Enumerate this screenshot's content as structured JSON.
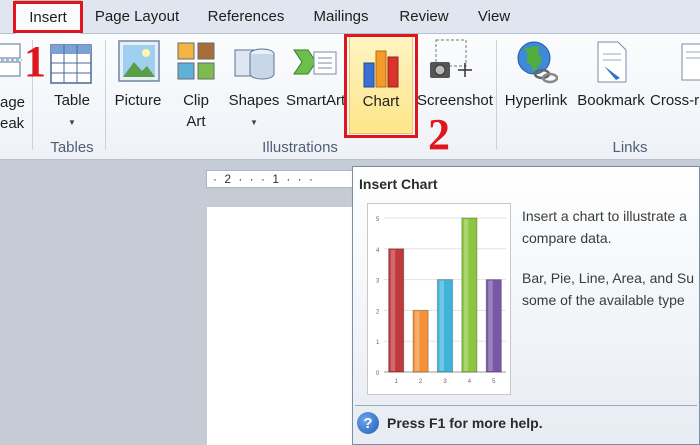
{
  "tabs": [
    "Insert",
    "Page Layout",
    "References",
    "Mailings",
    "Review",
    "View"
  ],
  "groups": {
    "pages": {
      "label_line1": "age",
      "label_line2": "eak"
    },
    "tables": {
      "label": "Tables",
      "table_button": "Table"
    },
    "illustrations": {
      "label": "Illustrations",
      "picture": "Picture",
      "clipart_line1": "Clip",
      "clipart_line2": "Art",
      "shapes": "Shapes",
      "smartart": "SmartArt",
      "chart": "Chart",
      "screenshot": "Screenshot"
    },
    "links": {
      "label": "Links",
      "hyperlink": "Hyperlink",
      "bookmark": "Bookmark",
      "crossref": "Cross-r"
    }
  },
  "annotations": {
    "step1": "1",
    "step2": "2"
  },
  "ruler": "· 2 · · · 1 · · ·",
  "tooltip": {
    "title": "Insert Chart",
    "desc1_line1": "Insert a chart to illustrate a",
    "desc1_line2": "compare data.",
    "desc2_line1": "Bar, Pie, Line, Area, and Su",
    "desc2_line2": "some of the available type",
    "help": "Press F1 for more help.",
    "help_icon": "?"
  },
  "chart_data": {
    "type": "bar",
    "categories": [
      "1",
      "2",
      "3",
      "4",
      "5"
    ],
    "values": [
      4,
      2,
      3,
      5,
      3
    ],
    "ylim": [
      0,
      5
    ],
    "yticks": [
      "0",
      "1",
      "2",
      "3",
      "4",
      "5"
    ],
    "colors": [
      "#c0393b",
      "#f39237",
      "#3fb4d8",
      "#8cc63f",
      "#7a58a8"
    ]
  },
  "colors": {
    "annotation_red": "#e0161e",
    "chart_highlight": "#fde58a"
  }
}
